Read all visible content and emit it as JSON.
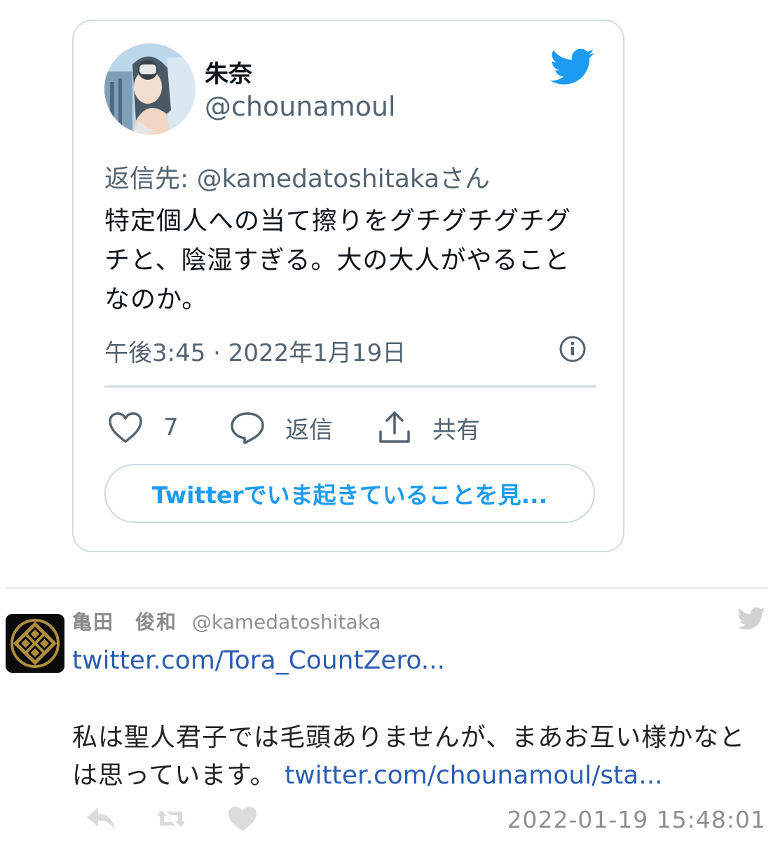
{
  "embed": {
    "display_name": "朱奈",
    "handle": "@chounamoul",
    "reply_prefix": "返信先: ",
    "reply_mention": "@kamedatoshitaka",
    "reply_suffix": "さん",
    "text": "特定個人への当て擦りをグチグチグチグチと、陰湿すぎる。大の大人がやることなのか。",
    "timestamp": "午後3:45 · 2022年1月19日",
    "like_count": "7",
    "reply_label": "返信",
    "share_label": "共有",
    "see_more_label": "Twitterでいま起きていることを見...",
    "icons": {
      "bird": "twitter-bird-icon",
      "info": "info-icon",
      "like": "heart-icon",
      "reply": "speech-bubble-icon",
      "share": "share-icon"
    },
    "colors": {
      "accent": "#1d9bf0",
      "muted": "#536471"
    }
  },
  "comment": {
    "author_name": "亀田　俊和",
    "author_handle": "@kamedatoshitaka",
    "link1": "twitter.com/Tora_CountZero...",
    "text": "私は聖人君子では毛頭ありませんが、まあお互い様かなとは思っています。",
    "link2": "twitter.com/chounamoul/sta...",
    "datetime": "2022-01-19 15:48:01",
    "icons": {
      "bird": "twitter-bird-icon",
      "reply": "reply-arrow-icon",
      "retweet": "retweet-icon",
      "like": "heart-icon"
    },
    "colors": {
      "link": "#2a5db0",
      "muted": "#8f8f8f"
    }
  }
}
